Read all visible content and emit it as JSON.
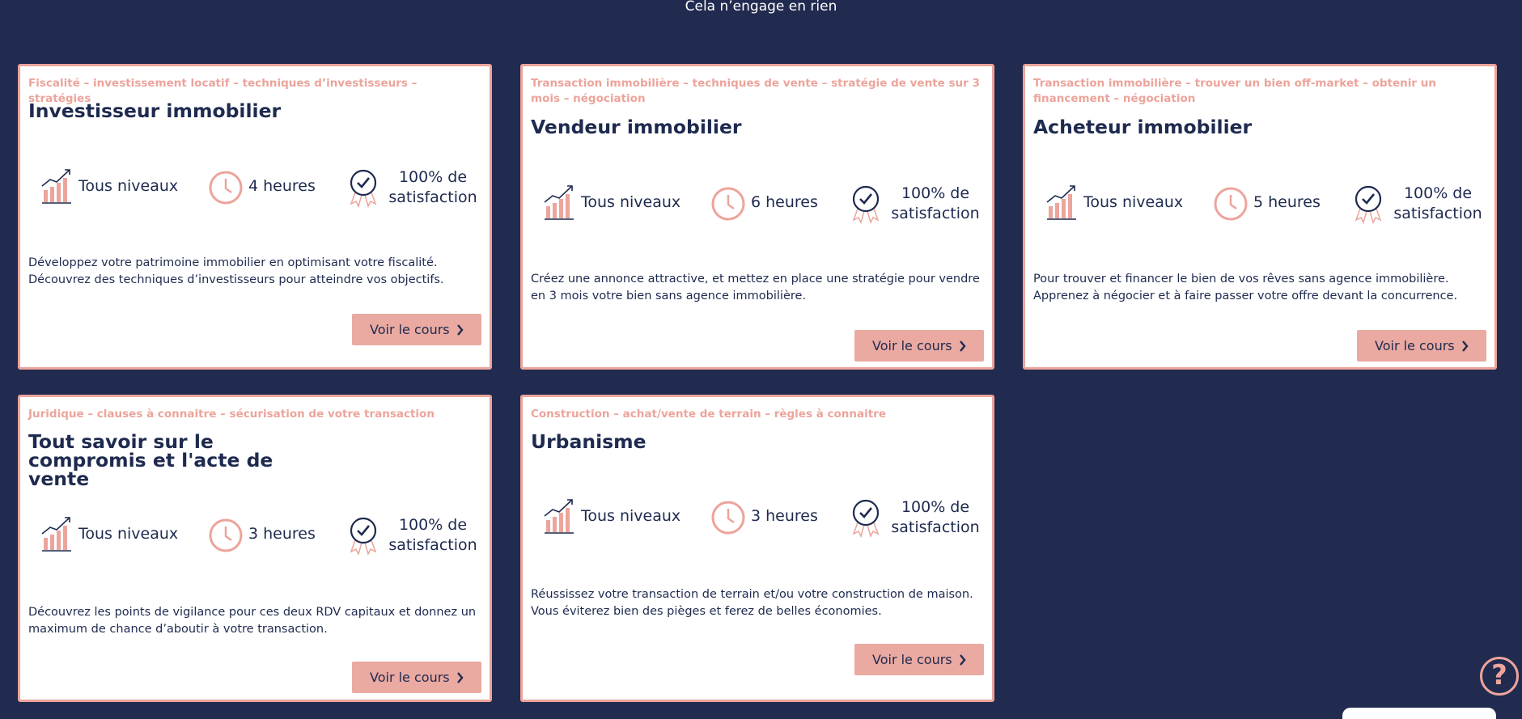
{
  "top_note": "Cela n’engage en rien",
  "colors": {
    "background": "#212a4f",
    "accent": "#eca49b",
    "button": "#eaa9a1",
    "text": "#1e2a4f"
  },
  "cards": [
    {
      "tags": "Fiscalité – investissement locatif – techniques d’investisseurs – stratégies",
      "title": "Investisseur immobilier",
      "level": "Tous niveaux",
      "duration": "4 heures",
      "satisfaction": "100% de satisfaction",
      "description": "Développez votre patrimoine immobilier en optimisant votre fiscalité. Découvrez des techniques d’investisseurs pour atteindre vos objectifs.",
      "cta": "Voir le cours"
    },
    {
      "tags": "Transaction immobilière – techniques de vente – stratégie de vente sur 3 mois – négociation",
      "title": "Vendeur immobilier",
      "level": "Tous niveaux",
      "duration": "6 heures",
      "satisfaction": "100% de satisfaction",
      "description": "Créez une annonce attractive, et mettez en place une stratégie pour vendre en 3 mois votre bien sans agence immobilière.",
      "cta": "Voir le cours"
    },
    {
      "tags": "Transaction immobilière – trouver un bien off-market – obtenir un financement – négociation",
      "title": "Acheteur immobilier",
      "level": "Tous niveaux",
      "duration": "5 heures",
      "satisfaction": "100% de satisfaction",
      "description": "Pour trouver et financer le bien de vos rêves sans agence immobilière. Apprenez à négocier et à faire passer votre offre devant la concurrence.",
      "cta": "Voir le cours"
    },
    {
      "tags": "Juridique – clauses à connaitre – sécurisation de votre transaction",
      "title": "Tout savoir sur le compromis et l'acte de vente",
      "level": "Tous niveaux",
      "duration": "3 heures",
      "satisfaction": "100% de satisfaction",
      "description": "Découvrez les points de vigilance  pour ces deux RDV capitaux et donnez un maximum de chance  d’aboutir à votre transaction.",
      "cta": "Voir le cours"
    },
    {
      "tags": "Construction – achat/vente de terrain – règles à connaitre",
      "title": "Urbanisme",
      "level": "Tous niveaux",
      "duration": "3 heures",
      "satisfaction": "100% de satisfaction",
      "description": "Réussissez votre transaction de terrain et/ou votre construction de maison. Vous éviterez bien des pièges et ferez de belles économies.",
      "cta": "Voir le cours"
    }
  ],
  "help": {
    "icon": "question-mark-icon",
    "label": "?"
  }
}
